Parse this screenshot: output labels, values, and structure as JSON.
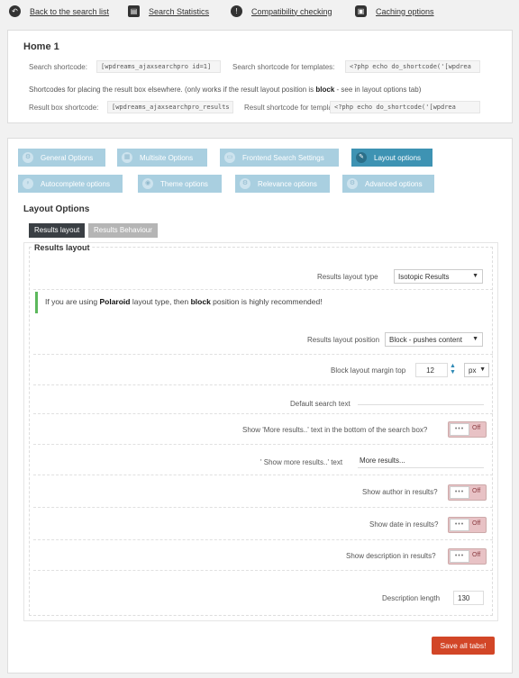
{
  "topnav": {
    "back": "Back to the search list",
    "stats": "Search Statistics",
    "compat": "Compatibility checking",
    "cache": "Caching options"
  },
  "home": {
    "title": "Home 1",
    "search_shortcode_label": "Search shortcode:",
    "search_shortcode_value": "[wpdreams_ajaxsearchpro id=1]",
    "template_shortcode_label": "Search shortcode for templates:",
    "template_shortcode_value": "<?php echo do_shortcode('[wpdrea",
    "note_pre": "Shortcodes for placing the result box elsewhere. (only works if the result layout position is ",
    "note_bold": "block",
    "note_post": " - see in layout options tab)",
    "result_shortcode_label": "Result box shortcode:",
    "result_shortcode_value": "[wpdreams_ajaxsearchpro_results",
    "result_template_label": "Result shortcode for templates:",
    "result_template_value": "<?php echo do_shortcode('[wpdrea"
  },
  "tabs": [
    {
      "label": "General Options",
      "icon": "gear-icon",
      "glyph": "⚙"
    },
    {
      "label": "Multisite Options",
      "icon": "network-icon",
      "glyph": "▦"
    },
    {
      "label": "Frontend Search Settings",
      "icon": "window-icon",
      "glyph": "▭"
    },
    {
      "label": "Layout options",
      "icon": "brush-icon",
      "glyph": "✎"
    },
    {
      "label": "Autocomplete options",
      "icon": "bulb-icon",
      "glyph": "♀"
    },
    {
      "label": "Theme options",
      "icon": "eye-icon",
      "glyph": "◉"
    },
    {
      "label": "Relevance options",
      "icon": "sliders-icon",
      "glyph": "⚙"
    },
    {
      "label": "Advanced options",
      "icon": "cog-icon",
      "glyph": "⚙"
    }
  ],
  "layout": {
    "title": "Layout Options",
    "subtab_results_layout": "Results layout",
    "subtab_results_behaviour": "Results Behaviour",
    "legend": "Results layout",
    "results_layout_type_label": "Results layout type",
    "results_layout_type_value": "Isotopic Results",
    "notice_pre": "If you are using ",
    "notice_b1": "Polaroid",
    "notice_mid": " layout type, then ",
    "notice_b2": "block",
    "notice_post": " position is highly recommended!",
    "position_label": "Results layout position",
    "position_value": "Block - pushes content",
    "margin_label": "Block layout margin top",
    "margin_value": "12",
    "margin_unit": "px",
    "default_text_label": "Default search text",
    "default_text_value": "",
    "show_more_label": "Show 'More results..' text in the bottom of the search box?",
    "show_more_text_label": "' Show more results..' text",
    "show_more_text_value": "More results...",
    "show_author_label": "Show author in results?",
    "show_date_label": "Show date in results?",
    "show_desc_label": "Show description in results?",
    "desc_length_label": "Description length",
    "desc_length_value": "130",
    "toggle_knob": "•••",
    "toggle_off": "Off"
  },
  "save_button": "Save all tabs!",
  "colors": {
    "tab": "#a9cfe0",
    "tab_active": "#3e93b3",
    "save": "#d24627",
    "notice_border": "#5cb85c"
  }
}
